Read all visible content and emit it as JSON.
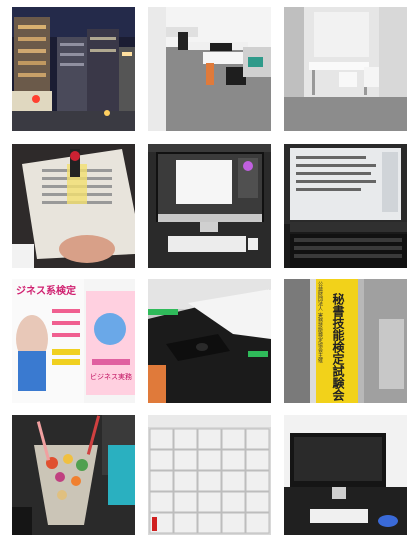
{
  "gallery": {
    "tiles": [
      {
        "id": "night-street"
      },
      {
        "id": "office-desks"
      },
      {
        "id": "meeting-room"
      },
      {
        "id": "newspaper-highlight"
      },
      {
        "id": "imac-desktop"
      },
      {
        "id": "laptop-screen"
      },
      {
        "id": "business-exam-posters",
        "poster_left": "ジネス系検定",
        "poster_right": "ビジネス実務"
      },
      {
        "id": "desk-mouse"
      },
      {
        "id": "exam-banner",
        "banner_top": "秘書技能検定試験会",
        "banner_small": "公益財団法人 実務技能検定協会主催"
      },
      {
        "id": "snack-cup"
      },
      {
        "id": "lockers"
      },
      {
        "id": "imac-desk"
      }
    ]
  }
}
